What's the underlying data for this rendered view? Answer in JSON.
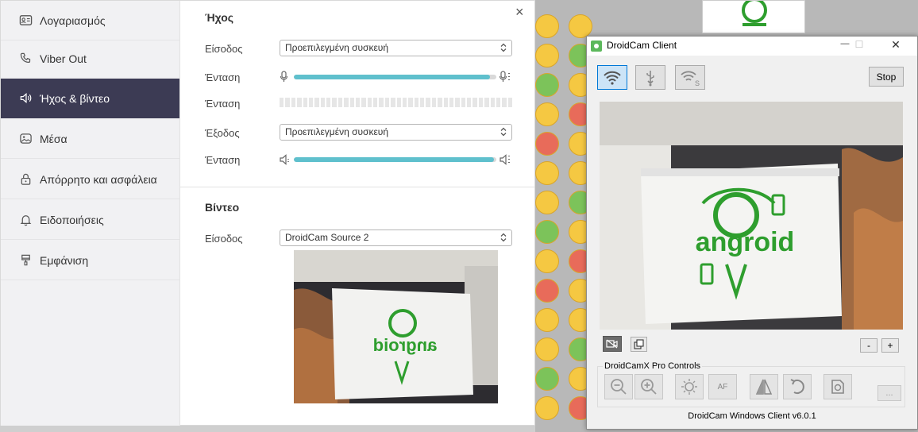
{
  "viber": {
    "sidebar": {
      "items": [
        {
          "label": "Λογαριασμός",
          "icon": "account-card-icon"
        },
        {
          "label": "Viber Out",
          "icon": "phone-icon"
        },
        {
          "label": "Ήχος & βίντεο",
          "icon": "speaker-icon",
          "active": true
        },
        {
          "label": "Μέσα",
          "icon": "image-icon"
        },
        {
          "label": "Απόρρητο και ασφάλεια",
          "icon": "lock-icon"
        },
        {
          "label": "Ειδοποιήσεις",
          "icon": "bell-icon"
        },
        {
          "label": "Εμφάνιση",
          "icon": "brush-icon"
        }
      ]
    },
    "close_label": "×",
    "audio": {
      "title": "Ήχος",
      "input_label": "Είσοδος",
      "input_value": "Προεπιλεγμένη συσκευή",
      "input_volume_label": "Ένταση",
      "input_volume_level": 0.97,
      "meter_label": "Ένταση",
      "meter_level": 0,
      "output_label": "Έξοδος",
      "output_value": "Προεπιλεγμένη συσκευή",
      "output_volume_label": "Ένταση",
      "output_volume_level": 0.99
    },
    "video": {
      "title": "Βίντεο",
      "input_label": "Είσοδος",
      "input_value": "DroidCam Source 2"
    }
  },
  "droidcam": {
    "title": "DroidCam Client",
    "minimize": "—",
    "maximize": "☐",
    "close": "✕",
    "stop_label": "Stop",
    "zoom_minus": "-",
    "zoom_plus": "+",
    "pro_controls_label": "DroidCamX Pro Controls",
    "af_label": "AF",
    "more_label": "...",
    "footer": "DroidCam Windows Client v6.0.1"
  },
  "colors": {
    "sidebar_active": "#3c3b54",
    "slider_fill": "#5fc0cd",
    "mode_active": "#cce4f7",
    "logo_green": "#2e9e2e"
  }
}
